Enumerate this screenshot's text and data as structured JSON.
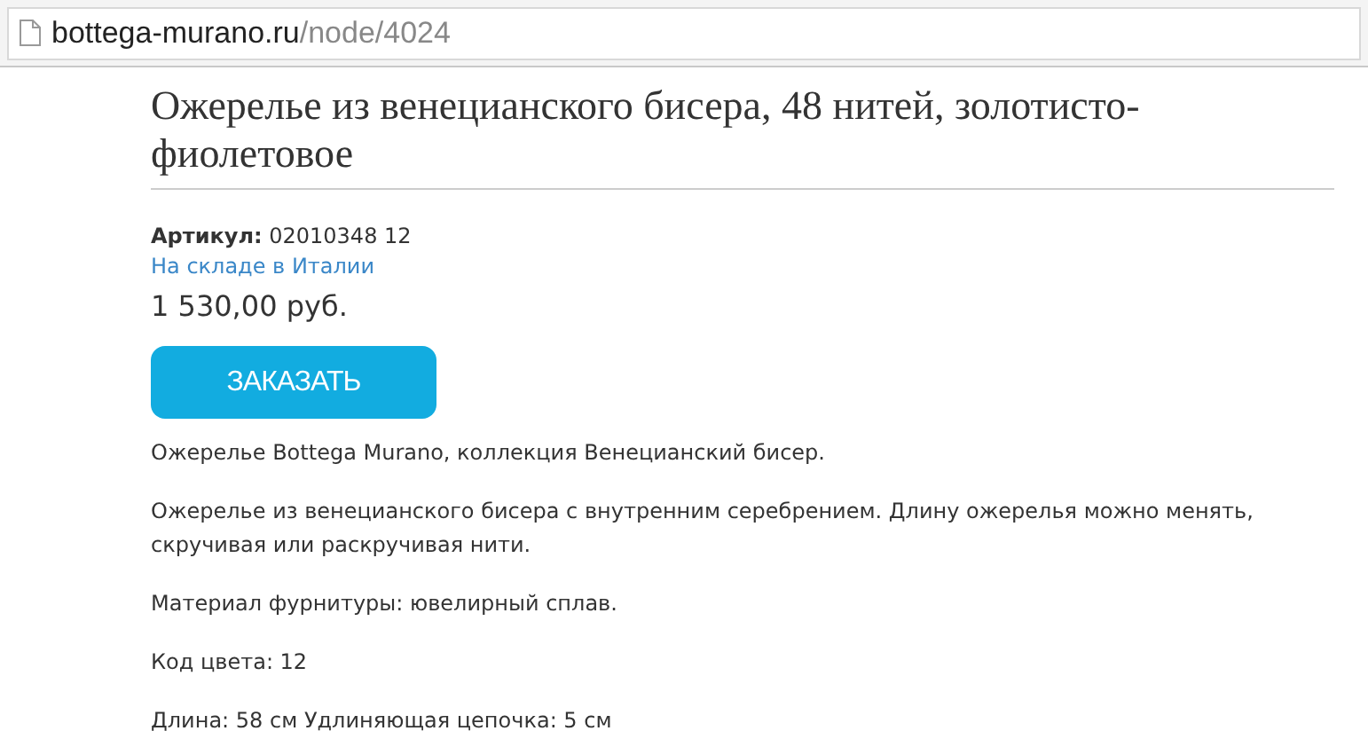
{
  "address_bar": {
    "host": "bottega-murano.ru",
    "path": "/node/4024"
  },
  "product": {
    "title": "Ожерелье из венецианского бисера, 48 нитей, золотисто-фиолетовое",
    "sku_label": "Артикул:",
    "sku": "02010348 12",
    "availability": "На складе в Италии",
    "price": "1 530,00 руб.",
    "order_button": "ЗАКАЗАТЬ",
    "description": [
      "Ожерелье Bottega Murano, коллекция Венецианский бисер.",
      "Ожерелье из венецианского бисера с внутренним серебрением. Длину ожерелья можно менять, скручивая или раскручивая нити.",
      "Материал фурнитуры: ювелирный сплав.",
      "Код цвета: 12",
      "Длина: 58 см Удлиняющая цепочка: 5 см"
    ]
  }
}
